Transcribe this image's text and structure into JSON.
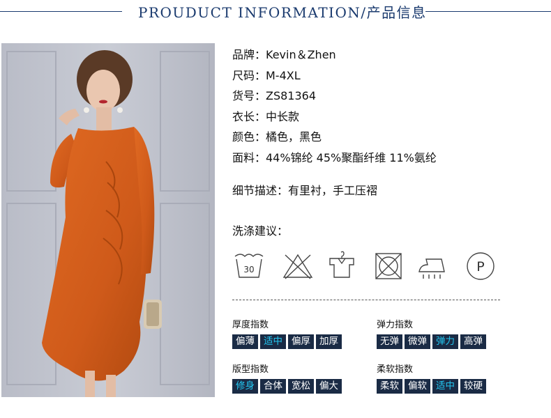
{
  "header": {
    "title": "PROUDUCT INFORMATION/产品信息"
  },
  "info": [
    "品牌：Kevin＆Zhen",
    "尺码：M-4XL",
    "货号：ZS81364",
    "衣长：中长款",
    "颜色：橘色，黑色",
    "面料：44%锦纶 45%聚酯纤维 11%氨纶"
  ],
  "detail": "细节描述：有里衬，手工压褶",
  "wash": {
    "label": "洗涤建议：",
    "icons": [
      "wash-30-icon",
      "do-not-bleach-icon",
      "hang-dry-icon",
      "do-not-tumble-dry-icon",
      "iron-steam-icon",
      "dry-clean-p-icon"
    ],
    "temp": "30",
    "dry_clean_letter": "P"
  },
  "indices": {
    "thickness": {
      "label": "厚度指数",
      "options": [
        "偏薄",
        "适中",
        "偏厚",
        "加厚"
      ],
      "active": 1
    },
    "elasticity": {
      "label": "弹力指数",
      "options": [
        "无弹",
        "微弹",
        "弹力",
        "高弹"
      ],
      "active": 2
    },
    "fit": {
      "label": "版型指数",
      "options": [
        "修身",
        "合体",
        "宽松",
        "偏大"
      ],
      "active": 0
    },
    "softness": {
      "label": "柔软指数",
      "options": [
        "柔软",
        "偏软",
        "适中",
        "较硬"
      ],
      "active": 2
    }
  },
  "colors": {
    "accent": "#23c6f0",
    "chip_bg": "#1a2b45",
    "header": "#1a3a6e",
    "dress": "#cf5a1a"
  }
}
